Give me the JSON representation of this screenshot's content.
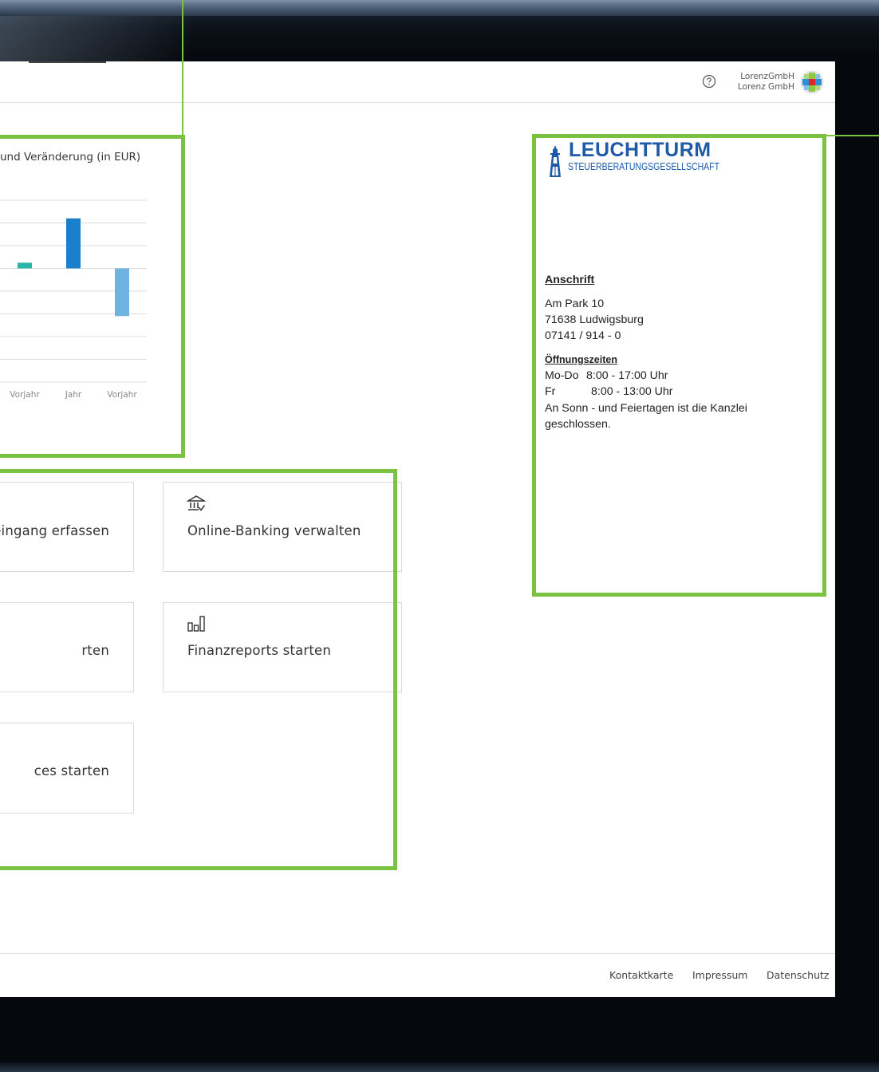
{
  "header": {
    "help_icon": "help-circle-icon",
    "user_line1": "LorenzGmbH",
    "user_line2": "Lorenz GmbH",
    "avatar_icon": "wolters-kluwer-logo"
  },
  "chart_data": {
    "type": "bar",
    "title": "und Veränderung (in EUR)",
    "categories": [
      "Vorjahr",
      "Jahr",
      "Vorjahr"
    ],
    "series": [
      {
        "values": [
          0.25,
          2.2,
          -2.1
        ]
      }
    ],
    "colors": [
      "#2bb5a8",
      "#1a7fcc",
      "#6fb4e0"
    ],
    "ylim": [
      -5,
      3
    ],
    "grid": true
  },
  "tiles": [
    {
      "label": "eingang erfassen",
      "icon": ""
    },
    {
      "label": "Online-Banking verwalten",
      "icon": "bank-icon"
    },
    {
      "label": "rten",
      "icon": ""
    },
    {
      "label": "Finanzreports starten",
      "icon": "bar-chart-icon"
    },
    {
      "label": "ces starten",
      "icon": ""
    }
  ],
  "info": {
    "logo_name": "LEUCHTTURM",
    "logo_sub": "STEUERBERATUNGSGESELLSCHAFT",
    "anschrift_heading": "Anschrift",
    "street": "Am Park 10",
    "city": "71638 Ludwigsburg",
    "phone": "07141 / 914 - 0",
    "hours_heading": "Öffnungszeiten",
    "hours": [
      {
        "day": "Mo-Do",
        "time": "8:00 - 17:00 Uhr"
      },
      {
        "day": "Fr",
        "time": "8:00 - 13:00 Uhr"
      }
    ],
    "note_line1": "An Sonn - und Feiertagen ist die Kanzlei",
    "note_line2": "geschlossen."
  },
  "footer": {
    "links": [
      "Kontaktkarte",
      "Impressum",
      "Datenschutz"
    ]
  },
  "colors": {
    "highlight": "#7cc242",
    "brand_blue": "#1d5aa8"
  }
}
